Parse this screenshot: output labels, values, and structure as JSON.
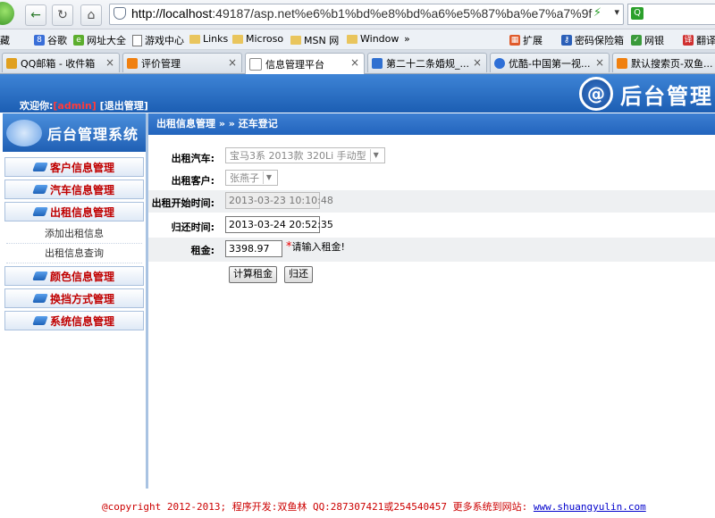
{
  "browser": {
    "url": "http://localhost:49187/asp.net%e6%b1%bd%e8%bd%a6%e5%87%ba%e7%a7%9f",
    "url_host": "http://localhost",
    "url_rest": ":49187/asp.net%e6%b1%bd%e8%bd%a6%e5%87%ba%e7%a7%9f",
    "search_icon": "search-icon",
    "bookmarks": [
      "藏",
      "谷歌",
      "网址大全",
      "游戏中心",
      "Links",
      "Microso",
      "MSN 网",
      "Window"
    ],
    "bookmarks_more": "»",
    "toolbar_right": [
      "扩展",
      "密码保险箱",
      "网银",
      "翻译"
    ],
    "tabs": [
      {
        "label": "QQ邮箱 - 收件箱",
        "icon_color": "#e0a020"
      },
      {
        "label": "评价管理",
        "icon_color": "#f08010"
      },
      {
        "label": "信息管理平台",
        "icon_color": "#ffffff"
      },
      {
        "label": "第二十二条婚规_...",
        "icon_color": "#3070d0"
      },
      {
        "label": "优酷-中国第一视...",
        "icon_color": "#2f6fd6"
      },
      {
        "label": "默认搜索页-双鱼...",
        "icon_color": "#f08010"
      }
    ]
  },
  "header": {
    "welcome_prefix": "欢迎你:",
    "user": "[admin]",
    "logout": "[退出管理]",
    "brand_mark": "@",
    "brand": "后台管理"
  },
  "sidebar": {
    "title": "后台管理系统",
    "menus": [
      {
        "label": "客户信息管理"
      },
      {
        "label": "汽车信息管理"
      },
      {
        "label": "出租信息管理"
      }
    ],
    "submenu": [
      "添加出租信息",
      "出租信息查询"
    ],
    "menus2": [
      {
        "label": "颜色信息管理"
      },
      {
        "label": "换挡方式管理"
      },
      {
        "label": "系统信息管理"
      }
    ]
  },
  "content": {
    "breadcrumb": "出租信息管理 » » 还车登记",
    "form": {
      "car_label": "出租汽车:",
      "car_value": "宝马3系 2013款 320Li 手动型",
      "customer_label": "出租客户:",
      "customer_value": "张燕子",
      "start_label": "出租开始时间:",
      "start_value": "2013-03-23 10:10:48",
      "return_label": "归还时间:",
      "return_value": "2013-03-24 20:52:35",
      "rent_label": "租金:",
      "rent_value": "3398.97",
      "rent_required": "*",
      "rent_hint": "请输入租金!",
      "calc_button": "计算租金",
      "return_button": "归还"
    }
  },
  "footer": {
    "text": "@copyright 2012-2013; 程序开发:双鱼林  QQ:287307421或254540457  更多系统到网站: ",
    "link": "www.shuangyulin.com"
  }
}
